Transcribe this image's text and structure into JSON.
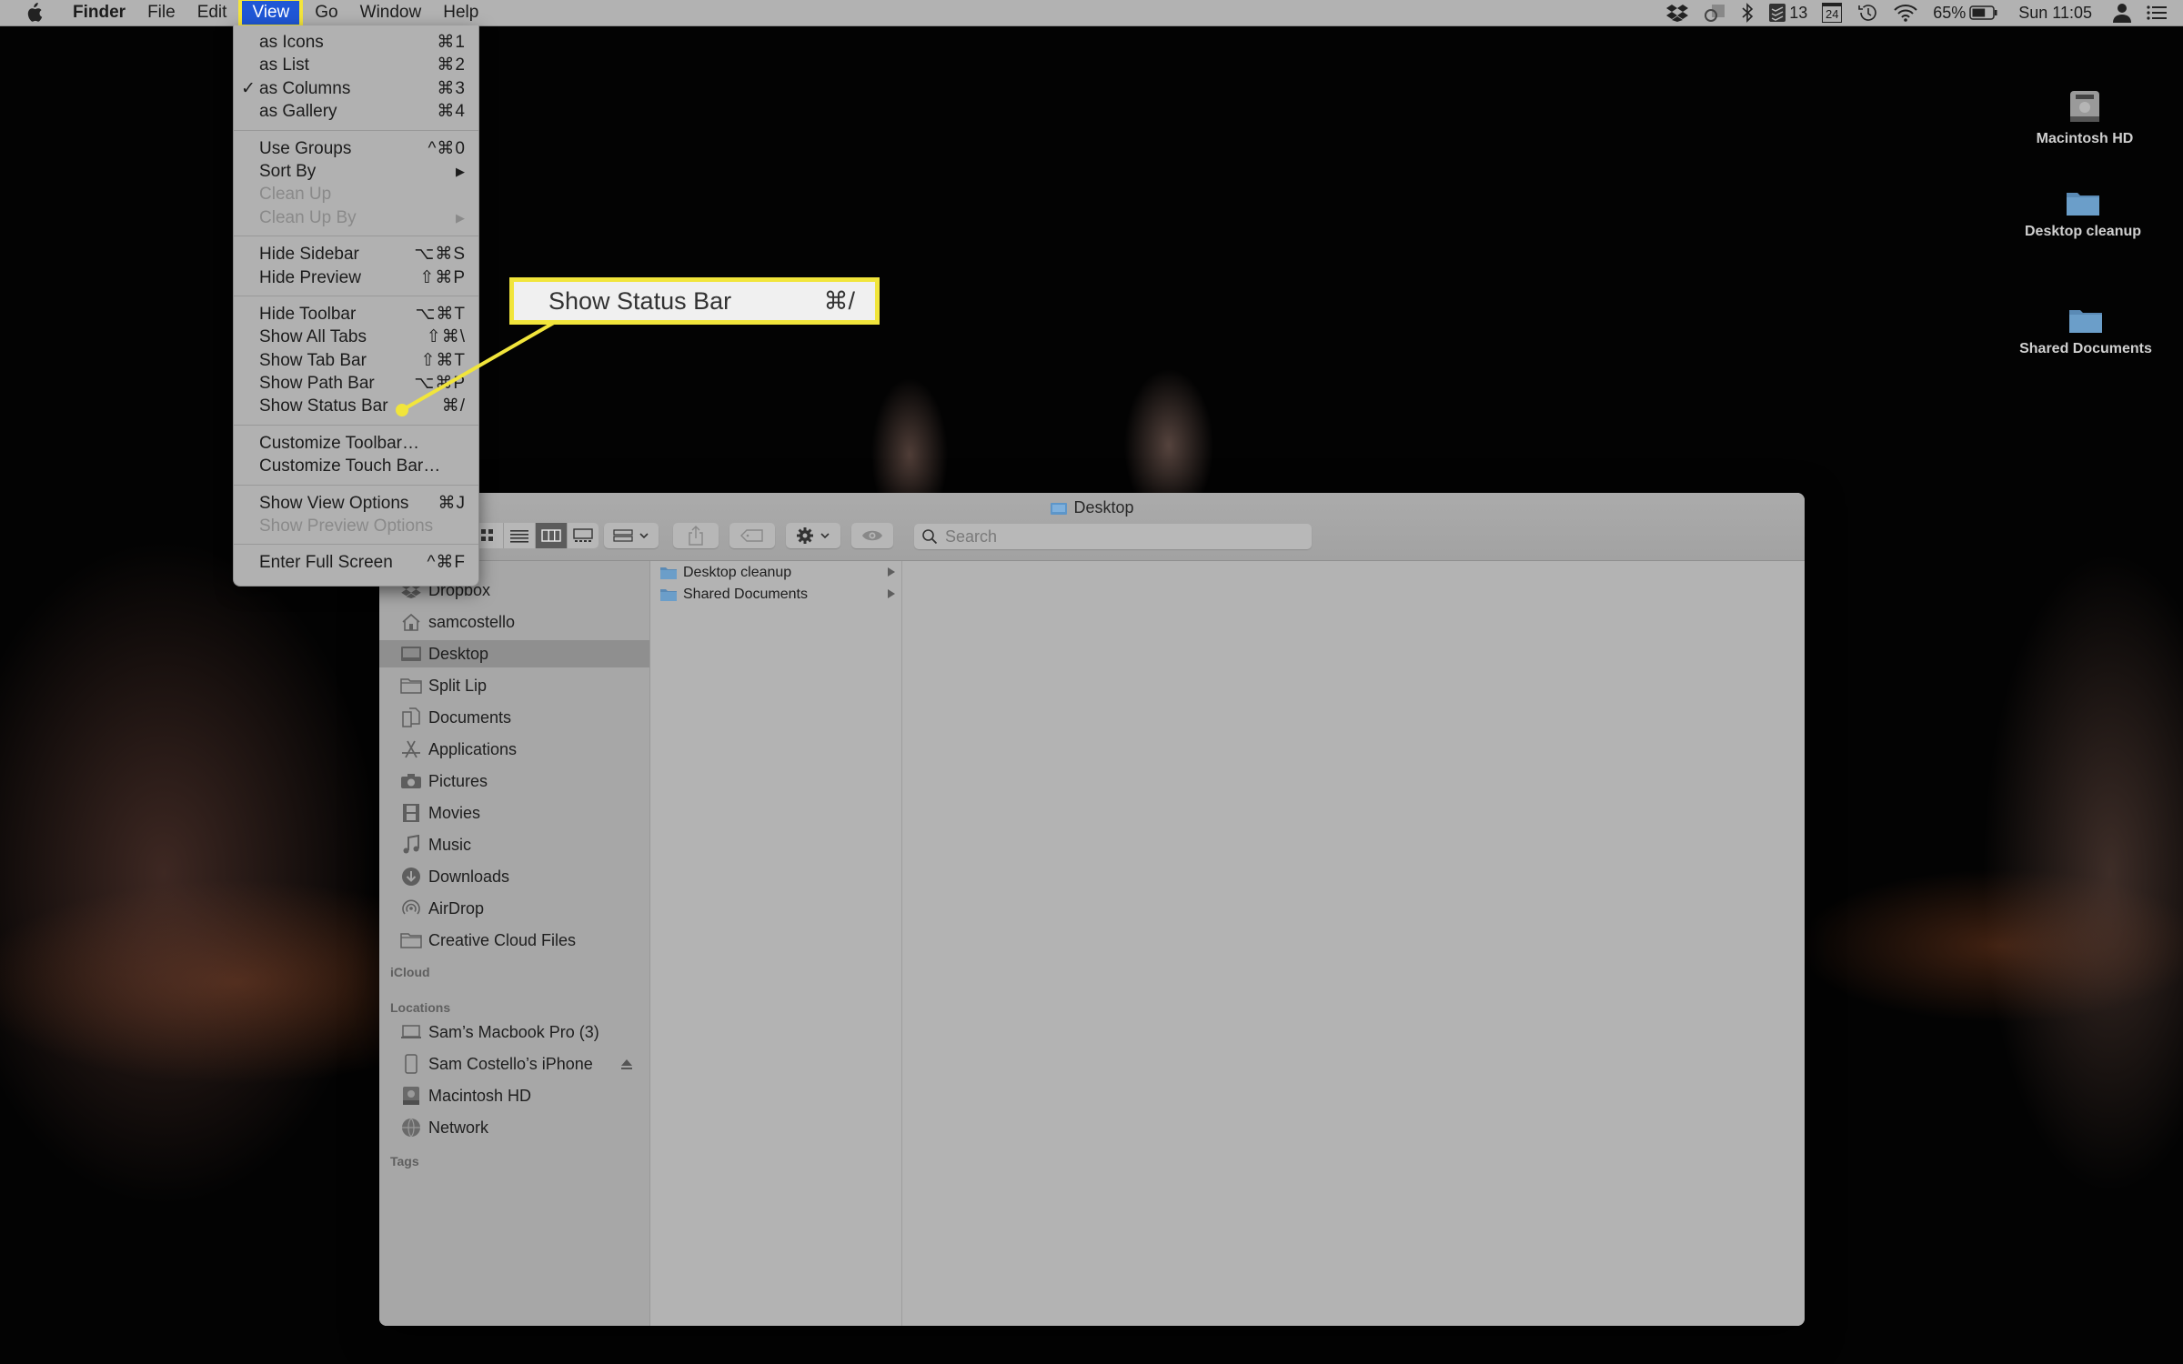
{
  "menubar": {
    "apple_icon": "apple-logo-icon",
    "items": [
      {
        "label": "Finder",
        "app": true
      },
      {
        "label": "File"
      },
      {
        "label": "Edit"
      },
      {
        "label": "View",
        "active": true
      },
      {
        "label": "Go"
      },
      {
        "label": "Window"
      },
      {
        "label": "Help"
      }
    ],
    "status": {
      "dropbox_icon": "dropbox-icon",
      "creative_cloud_icon": "creative-cloud-icon",
      "bluetooth_icon": "bluetooth-icon",
      "todoist_count": "13",
      "calendar_day": "24",
      "time_machine_icon": "time-machine-icon",
      "wifi_icon": "wifi-icon",
      "battery_percent": "65%",
      "battery_level": 0.65,
      "clock": "Sun 11:05",
      "user_icon": "user-icon",
      "notification_center_icon": "list-icon"
    }
  },
  "view_menu": {
    "groups": [
      [
        {
          "label": "as Icons",
          "shortcut": "⌘1"
        },
        {
          "label": "as List",
          "shortcut": "⌘2"
        },
        {
          "label": "as Columns",
          "shortcut": "⌘3",
          "checked": true
        },
        {
          "label": "as Gallery",
          "shortcut": "⌘4"
        }
      ],
      [
        {
          "label": "Use Groups",
          "shortcut": "^⌘0"
        },
        {
          "label": "Sort By",
          "shortcut": "▶"
        },
        {
          "label": "Clean Up",
          "shortcut": "",
          "disabled": true
        },
        {
          "label": "Clean Up By",
          "shortcut": "▶",
          "disabled": true
        }
      ],
      [
        {
          "label": "Hide Sidebar",
          "shortcut": "⌥⌘S"
        },
        {
          "label": "Hide Preview",
          "shortcut": "⇧⌘P"
        }
      ],
      [
        {
          "label": "Hide Toolbar",
          "shortcut": "⌥⌘T"
        },
        {
          "label": "Show All Tabs",
          "shortcut": "⇧⌘\\"
        },
        {
          "label": "Show Tab Bar",
          "shortcut": "⇧⌘T"
        },
        {
          "label": "Show Path Bar",
          "shortcut": "⌥⌘P"
        },
        {
          "label": "Show Status Bar",
          "shortcut": "⌘/"
        }
      ],
      [
        {
          "label": "Customize Toolbar…",
          "shortcut": ""
        },
        {
          "label": "Customize Touch Bar…",
          "shortcut": ""
        }
      ],
      [
        {
          "label": "Show View Options",
          "shortcut": "⌘J"
        },
        {
          "label": "Show Preview Options",
          "shortcut": "",
          "disabled": true
        }
      ],
      [
        {
          "label": "Enter Full Screen",
          "shortcut": "^⌘F"
        }
      ]
    ]
  },
  "callout": {
    "label": "Show Status Bar",
    "shortcut": "⌘/",
    "highlight_color": "#f1e53b"
  },
  "desktop_icons": [
    {
      "label": "Macintosh HD",
      "icon": "hard-drive-icon"
    },
    {
      "label": "Desktop cleanup",
      "icon": "folder-icon"
    },
    {
      "label": "Shared Documents",
      "icon": "folder-icon"
    }
  ],
  "finder": {
    "title": "Desktop",
    "search_placeholder": "Search",
    "toolbar": {
      "view_buttons": [
        "icon-view",
        "list-view",
        "column-view",
        "gallery-view"
      ],
      "active_view": "column-view",
      "group_button": "group-icon",
      "share_button": "share-icon",
      "tag_button": "tag-icon",
      "action_button": "gear-icon",
      "quicklook_button": "eye-icon"
    },
    "sidebar": {
      "favorites": [
        {
          "label": "Dropbox",
          "icon": "dropbox-icon"
        },
        {
          "label": "samcostello",
          "icon": "home-icon"
        },
        {
          "label": "Desktop",
          "icon": "desktop-icon",
          "selected": true
        },
        {
          "label": "Split Lip",
          "icon": "folder-icon"
        },
        {
          "label": "Documents",
          "icon": "documents-icon"
        },
        {
          "label": "Applications",
          "icon": "applications-icon"
        },
        {
          "label": "Pictures",
          "icon": "camera-icon"
        },
        {
          "label": "Movies",
          "icon": "film-icon"
        },
        {
          "label": "Music",
          "icon": "music-note-icon"
        },
        {
          "label": "Downloads",
          "icon": "download-icon"
        },
        {
          "label": "AirDrop",
          "icon": "airdrop-icon"
        },
        {
          "label": "Creative Cloud Files",
          "icon": "folder-icon"
        }
      ],
      "icloud_header": "iCloud",
      "locations_header": "Locations",
      "locations": [
        {
          "label": "Sam’s Macbook Pro (3)",
          "icon": "laptop-icon"
        },
        {
          "label": "Sam Costello’s iPhone",
          "icon": "iphone-icon",
          "eject": true
        },
        {
          "label": "Macintosh HD",
          "icon": "hard-drive-icon"
        },
        {
          "label": "Network",
          "icon": "globe-icon"
        }
      ],
      "tags_header": "Tags"
    },
    "column1": [
      {
        "label": "Desktop cleanup",
        "icon": "folder-icon"
      },
      {
        "label": "Shared Documents",
        "icon": "folder-icon"
      }
    ]
  }
}
